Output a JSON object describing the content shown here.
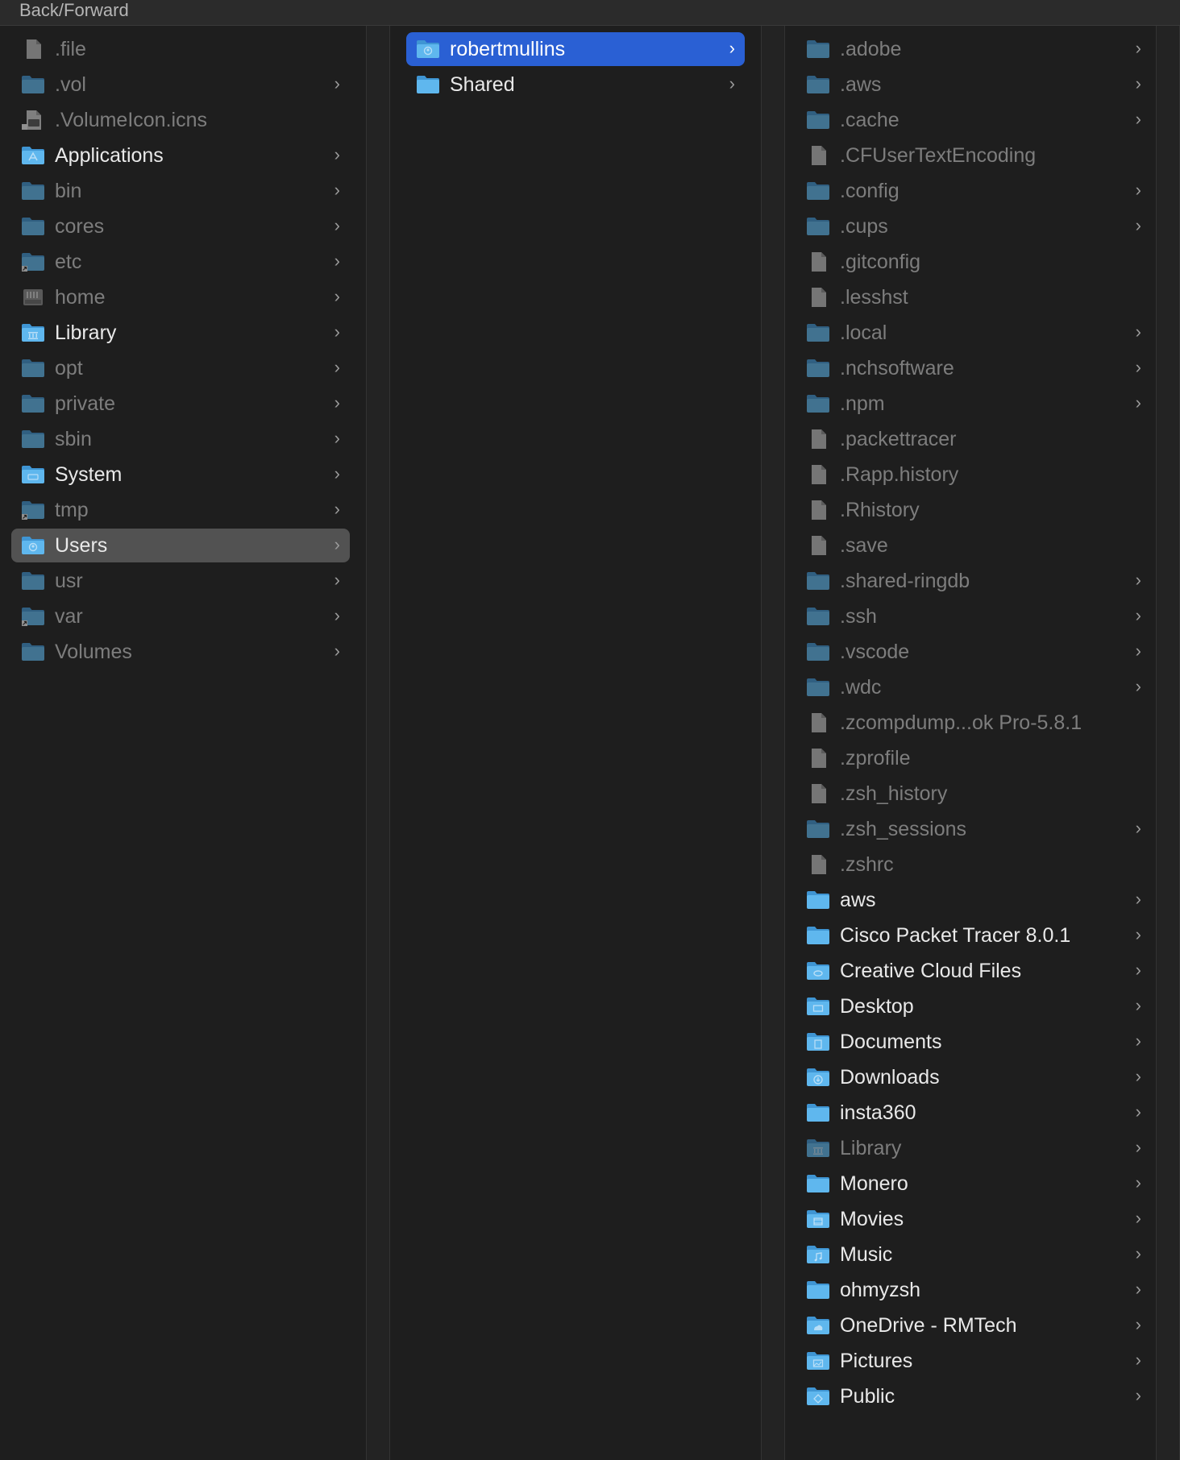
{
  "topbar": {
    "label": "Back/Forward"
  },
  "columns": [
    {
      "items": [
        {
          "name": ".file",
          "kind": "file",
          "dim": true,
          "chevron": false
        },
        {
          "name": ".vol",
          "kind": "folder",
          "dim": true,
          "chevron": true
        },
        {
          "name": ".VolumeIcon.icns",
          "kind": "icns",
          "dim": true,
          "chevron": false
        },
        {
          "name": "Applications",
          "kind": "folder-apps",
          "dim": false,
          "chevron": true
        },
        {
          "name": "bin",
          "kind": "folder",
          "dim": true,
          "chevron": true
        },
        {
          "name": "cores",
          "kind": "folder",
          "dim": true,
          "chevron": true
        },
        {
          "name": "etc",
          "kind": "folder-alias",
          "dim": true,
          "chevron": true
        },
        {
          "name": "home",
          "kind": "server",
          "dim": true,
          "chevron": true
        },
        {
          "name": "Library",
          "kind": "folder-library",
          "dim": false,
          "chevron": true
        },
        {
          "name": "opt",
          "kind": "folder",
          "dim": true,
          "chevron": true
        },
        {
          "name": "private",
          "kind": "folder",
          "dim": true,
          "chevron": true
        },
        {
          "name": "sbin",
          "kind": "folder",
          "dim": true,
          "chevron": true
        },
        {
          "name": "System",
          "kind": "folder-system",
          "dim": false,
          "chevron": true
        },
        {
          "name": "tmp",
          "kind": "folder-alias",
          "dim": true,
          "chevron": true
        },
        {
          "name": "Users",
          "kind": "folder-users",
          "dim": false,
          "chevron": true,
          "selected": "grey"
        },
        {
          "name": "usr",
          "kind": "folder",
          "dim": true,
          "chevron": true
        },
        {
          "name": "var",
          "kind": "folder-alias",
          "dim": true,
          "chevron": true
        },
        {
          "name": "Volumes",
          "kind": "folder",
          "dim": true,
          "chevron": true
        }
      ]
    },
    {
      "items": [
        {
          "name": "robertmullins",
          "kind": "folder-home",
          "dim": false,
          "chevron": true,
          "selected": "blue"
        },
        {
          "name": "Shared",
          "kind": "folder",
          "dim": false,
          "chevron": true
        }
      ]
    },
    {
      "items": [
        {
          "name": ".adobe",
          "kind": "folder",
          "dim": true,
          "chevron": true
        },
        {
          "name": ".aws",
          "kind": "folder",
          "dim": true,
          "chevron": true
        },
        {
          "name": ".cache",
          "kind": "folder",
          "dim": true,
          "chevron": true
        },
        {
          "name": ".CFUserTextEncoding",
          "kind": "file",
          "dim": true,
          "chevron": false
        },
        {
          "name": ".config",
          "kind": "folder",
          "dim": true,
          "chevron": true
        },
        {
          "name": ".cups",
          "kind": "folder",
          "dim": true,
          "chevron": true
        },
        {
          "name": ".gitconfig",
          "kind": "file",
          "dim": true,
          "chevron": false
        },
        {
          "name": ".lesshst",
          "kind": "file",
          "dim": true,
          "chevron": false
        },
        {
          "name": ".local",
          "kind": "folder",
          "dim": true,
          "chevron": true
        },
        {
          "name": ".nchsoftware",
          "kind": "folder",
          "dim": true,
          "chevron": true
        },
        {
          "name": ".npm",
          "kind": "folder",
          "dim": true,
          "chevron": true
        },
        {
          "name": ".packettracer",
          "kind": "file",
          "dim": true,
          "chevron": false
        },
        {
          "name": ".Rapp.history",
          "kind": "file",
          "dim": true,
          "chevron": false
        },
        {
          "name": ".Rhistory",
          "kind": "file",
          "dim": true,
          "chevron": false
        },
        {
          "name": ".save",
          "kind": "file",
          "dim": true,
          "chevron": false
        },
        {
          "name": ".shared-ringdb",
          "kind": "folder",
          "dim": true,
          "chevron": true
        },
        {
          "name": ".ssh",
          "kind": "folder",
          "dim": true,
          "chevron": true
        },
        {
          "name": ".vscode",
          "kind": "folder",
          "dim": true,
          "chevron": true
        },
        {
          "name": ".wdc",
          "kind": "folder",
          "dim": true,
          "chevron": true
        },
        {
          "name": ".zcompdump...ok Pro-5.8.1",
          "kind": "file",
          "dim": true,
          "chevron": false
        },
        {
          "name": ".zprofile",
          "kind": "file",
          "dim": true,
          "chevron": false
        },
        {
          "name": ".zsh_history",
          "kind": "file",
          "dim": true,
          "chevron": false
        },
        {
          "name": ".zsh_sessions",
          "kind": "folder",
          "dim": true,
          "chevron": true
        },
        {
          "name": ".zshrc",
          "kind": "file",
          "dim": true,
          "chevron": false
        },
        {
          "name": "aws",
          "kind": "folder",
          "dim": false,
          "chevron": true
        },
        {
          "name": "Cisco Packet Tracer 8.0.1",
          "kind": "folder",
          "dim": false,
          "chevron": true
        },
        {
          "name": "Creative Cloud Files",
          "kind": "folder-cc",
          "dim": false,
          "chevron": true
        },
        {
          "name": "Desktop",
          "kind": "folder-desktop",
          "dim": false,
          "chevron": true
        },
        {
          "name": "Documents",
          "kind": "folder-documents",
          "dim": false,
          "chevron": true
        },
        {
          "name": "Downloads",
          "kind": "folder-downloads",
          "dim": false,
          "chevron": true
        },
        {
          "name": "insta360",
          "kind": "folder",
          "dim": false,
          "chevron": true
        },
        {
          "name": "Library",
          "kind": "folder-library",
          "dim": true,
          "chevron": true
        },
        {
          "name": "Monero",
          "kind": "folder",
          "dim": false,
          "chevron": true
        },
        {
          "name": "Movies",
          "kind": "folder-movies",
          "dim": false,
          "chevron": true
        },
        {
          "name": "Music",
          "kind": "folder-music",
          "dim": false,
          "chevron": true
        },
        {
          "name": "ohmyzsh",
          "kind": "folder",
          "dim": false,
          "chevron": true
        },
        {
          "name": "OneDrive - RMTech",
          "kind": "folder-cloud",
          "dim": false,
          "chevron": true
        },
        {
          "name": "Pictures",
          "kind": "folder-pictures",
          "dim": false,
          "chevron": true
        },
        {
          "name": "Public",
          "kind": "folder-public",
          "dim": false,
          "chevron": true
        }
      ]
    }
  ],
  "colors": {
    "folder": "#5fb7ee",
    "folder_dark": "#3f95d3",
    "selection_blue": "#2a60d4",
    "selection_grey": "#525252"
  }
}
